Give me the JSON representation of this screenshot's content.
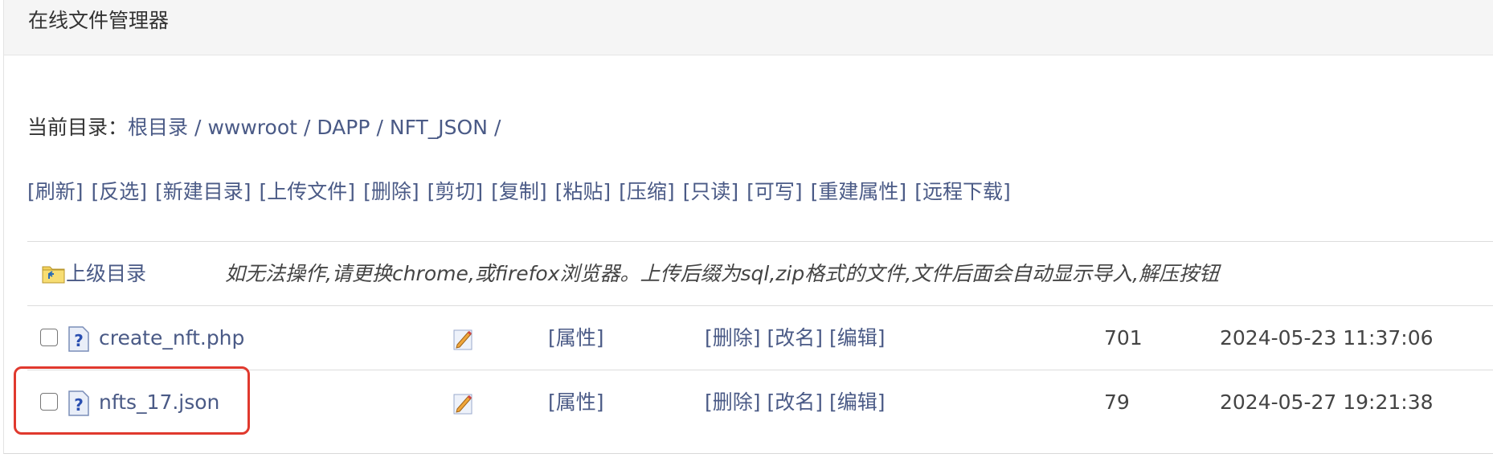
{
  "panel": {
    "title": "在线文件管理器"
  },
  "breadcrumb": {
    "prefix": "当前目录：",
    "parts": [
      "根目录",
      "wwwroot",
      "DAPP",
      "NFT_JSON"
    ],
    "trailing_sep": "/"
  },
  "toolbar": {
    "items": [
      "[刷新]",
      "[反选]",
      "[新建目录]",
      "[上传文件]",
      "[删除]",
      "[剪切]",
      "[复制]",
      "[粘贴]",
      "[压缩]",
      "[只读]",
      "[可写]",
      "[重建属性]",
      "[远程下载]"
    ]
  },
  "table": {
    "parent_label": "上级目录",
    "notice": "如无法操作,请更换chrome,或firefox浏览器。上传后缀为sql,zip格式的文件,文件后面会自动显示导入,解压按钮",
    "files": [
      {
        "name": "create_nft.php",
        "attr": "[属性]",
        "delete": "[删除]",
        "rename": "[改名]",
        "edit": "[编辑]",
        "size": "701",
        "mtime": "2024-05-23 11:37:06"
      },
      {
        "name": "nfts_17.json",
        "attr": "[属性]",
        "delete": "[删除]",
        "rename": "[改名]",
        "edit": "[编辑]",
        "size": "79",
        "mtime": "2024-05-27 19:21:38"
      }
    ]
  },
  "icons": {
    "folder": "folder-up-icon",
    "file": "unknown-file-icon",
    "edit": "pencil-edit-icon"
  },
  "colors": {
    "link": "#4a5a86",
    "highlight": "#e0392e",
    "header_bg": "#f5f5f5"
  }
}
